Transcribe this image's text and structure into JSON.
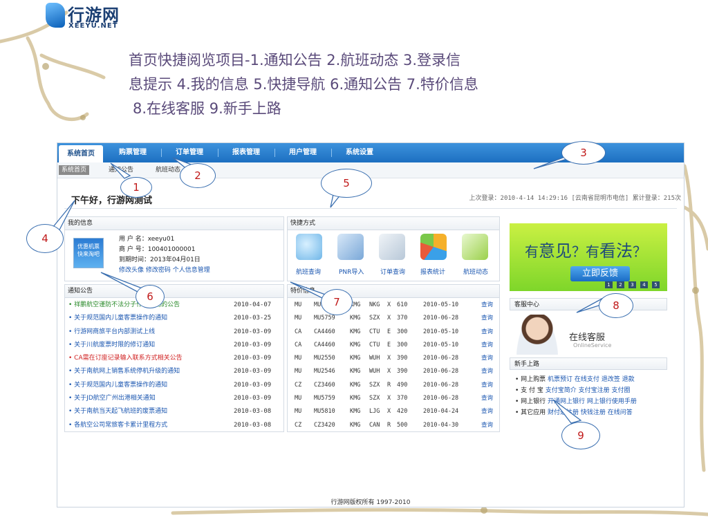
{
  "logo": {
    "cn": "行游网",
    "en": "XEEYU.NET"
  },
  "caption_lines": [
    "首页快捷阅览项目-1.通知公告 2.航班动态 3.登录信",
    "息提示 4.我的信息 5.快捷导航 6.通知公告 7.特价信息",
    "8.在线客服 9.新手上路"
  ],
  "nav": {
    "items": [
      "系统首页",
      "购票管理",
      "订单管理",
      "报表管理",
      "用户管理",
      "系统设置"
    ]
  },
  "subnav": {
    "items": [
      "系统首页",
      "通知公告",
      "航班动态"
    ]
  },
  "greeting": "下午好，行游网测试",
  "last_login": "上次登录：2010-4-14 14:29:16 [云南省昆明市电信] 累计登录：215次",
  "myinfo": {
    "title": "我的信息",
    "avatar_text": [
      "优惠机票",
      "快来淘吧"
    ],
    "username": "用 户 名：xeeyu01",
    "merchant": "商 户 号：100401000001",
    "expire": "到期时间：2013年04月01日",
    "links": [
      "修改头像",
      "修改密码",
      "个人信息管理"
    ]
  },
  "quick": {
    "title": "快捷方式",
    "items": [
      "航班查询",
      "PNR导入",
      "订单查询",
      "报表统计",
      "航班动态"
    ]
  },
  "notice": {
    "title": "通知公告",
    "rows": [
      {
        "text": "• 祥鹏航空谨防不法分子作恶活动的公告",
        "date": "2010-04-07"
      },
      {
        "text": "• 关于规范国内儿童客票操作的通知",
        "date": "2010-03-25"
      },
      {
        "text": "• 行游网商旅平台内部测试上线",
        "date": "2010-03-09"
      },
      {
        "text": "• 关于川航废票时限的修订通知",
        "date": "2010-03-09"
      },
      {
        "text": "• CA需在订座记录输入联系方式相关公告",
        "date": "2010-03-09"
      },
      {
        "text": "• 关于南航网上销售系统停机升级的通知",
        "date": "2010-03-09"
      },
      {
        "text": "• 关于规范国内儿童客票操作的通知",
        "date": "2010-03-09"
      },
      {
        "text": "• 关于JD航空广州出港相关通知",
        "date": "2010-03-09"
      },
      {
        "text": "• 关于南航当天起飞航班的废票通知",
        "date": "2010-03-08"
      },
      {
        "text": "• 各航空公司常旅客卡累计里程方式",
        "date": "2010-03-08"
      }
    ]
  },
  "deals": {
    "title": "特价信息",
    "query_label": "查询",
    "rows": [
      [
        "MU",
        "MU2546",
        "KMG",
        "NKG",
        "X",
        "610",
        "2010-05-10"
      ],
      [
        "MU",
        "MU5759",
        "KMG",
        "SZX",
        "X",
        "370",
        "2010-06-28"
      ],
      [
        "CA",
        "CA4460",
        "KMG",
        "CTU",
        "E",
        "300",
        "2010-05-10"
      ],
      [
        "CA",
        "CA4460",
        "KMG",
        "CTU",
        "E",
        "300",
        "2010-05-10"
      ],
      [
        "MU",
        "MU2550",
        "KMG",
        "WUH",
        "X",
        "390",
        "2010-06-28"
      ],
      [
        "MU",
        "MU2546",
        "KMG",
        "WUH",
        "X",
        "390",
        "2010-06-28"
      ],
      [
        "CZ",
        "CZ3460",
        "KMG",
        "SZX",
        "R",
        "490",
        "2010-06-28"
      ],
      [
        "MU",
        "MU5759",
        "KMG",
        "SZX",
        "X",
        "370",
        "2010-06-28"
      ],
      [
        "MU",
        "MU5810",
        "KMG",
        "LJG",
        "X",
        "420",
        "2010-04-24"
      ],
      [
        "CZ",
        "CZ3420",
        "KMG",
        "CAN",
        "R",
        "500",
        "2010-04-30"
      ]
    ]
  },
  "banner": {
    "line1a": "有",
    "line1b": "意见",
    "line1c": "？有",
    "line1d": "看法",
    "line1e": "？",
    "button": "立即反馈",
    "pages": [
      "1",
      "2",
      "3",
      "4",
      "5"
    ]
  },
  "service": {
    "title": "客服中心",
    "label": "在线客服",
    "sub": "OnlineService"
  },
  "help": {
    "title": "新手上路",
    "rows": [
      {
        "head": "• 网上购票",
        "links": "机票预订  在线支付  退改签  退款"
      },
      {
        "head": "• 支 付 宝",
        "links": "支付宝简介  支付宝注册  支付圈"
      },
      {
        "head": "• 网上银行",
        "links": "开通网上银行  网上银行使用手册"
      },
      {
        "head": "• 其它应用",
        "links": "财付通注册  快钱注册  在线问答"
      }
    ]
  },
  "footer": "行游网版权所有 1997-2010",
  "callouts": [
    "1",
    "2",
    "3",
    "4",
    "5",
    "6",
    "7",
    "8",
    "9"
  ],
  "colors": {
    "nav": "#1c6fc1",
    "callout_text": "#c01818",
    "link": "#1a56b0"
  }
}
